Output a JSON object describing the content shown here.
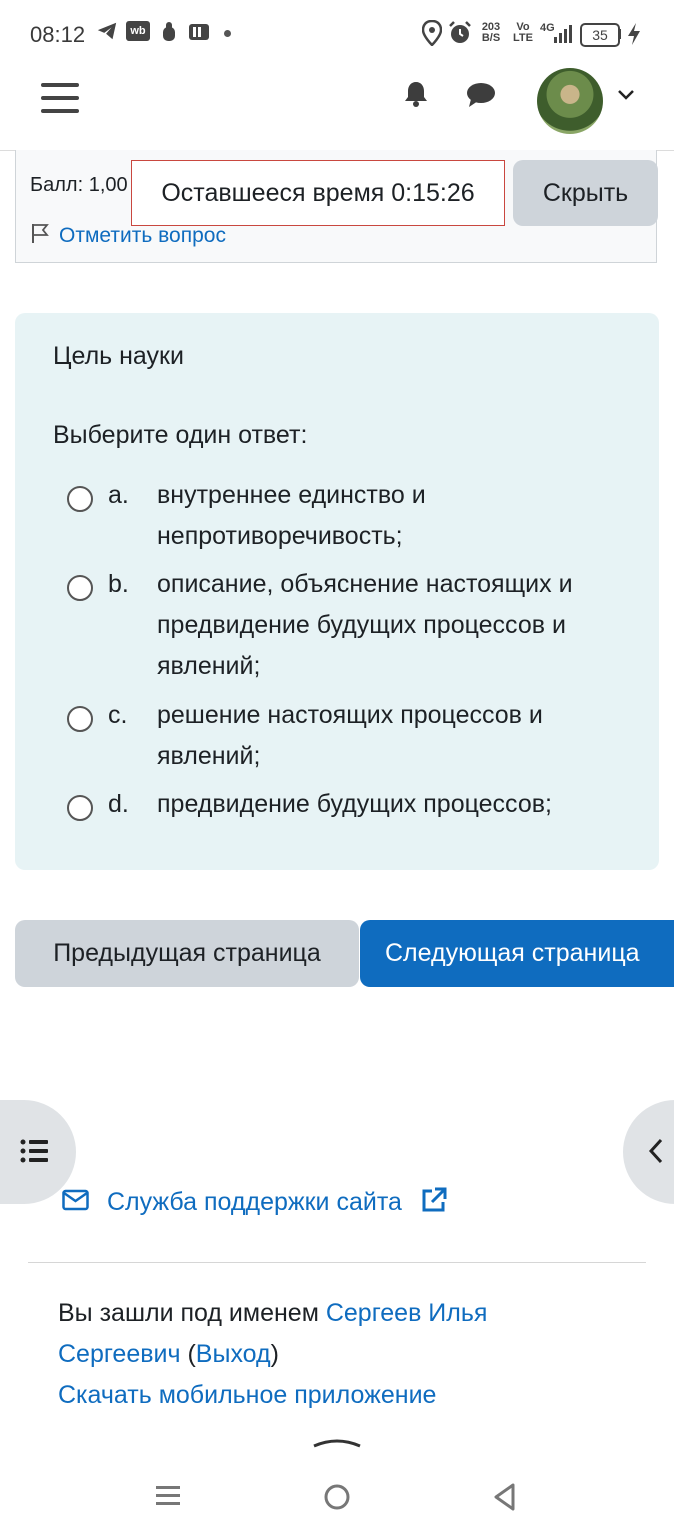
{
  "status_bar": {
    "time": "08:12",
    "speed_value": "203",
    "speed_unit": "B/S",
    "volte": "Vo LTE",
    "network": "4G",
    "battery": "35"
  },
  "quiz_info": {
    "score": "Балл: 1,00",
    "flag_label": "Отметить вопрос",
    "timer": "Оставшееся время 0:15:26",
    "hide_button": "Скрыть"
  },
  "question": {
    "text": "Цель науки",
    "prompt": "Выберите один ответ:",
    "options": [
      {
        "letter": "a.",
        "text": "внутреннее единство и непротиворечивость;"
      },
      {
        "letter": "b.",
        "text": "описание, объяснение настоящих и предвидение будущих процессов и явлений;"
      },
      {
        "letter": "c.",
        "text": "решение настоящих процессов и явлений;"
      },
      {
        "letter": "d.",
        "text": "предвидение будущих процессов;"
      }
    ]
  },
  "navigation": {
    "prev": "Предыдущая страница",
    "next": "Следующая страница"
  },
  "footer": {
    "support": "Служба поддержки сайта",
    "logged_in_as": "Вы зашли под именем",
    "user_name_1": "Сергеев Илья",
    "user_name_2": "Сергеевич",
    "logout_open": "(",
    "logout": "Выход",
    "logout_close": ")",
    "mobile_app": "Скачать мобильное приложение"
  },
  "icons": {
    "menu": "hamburger-icon",
    "notifications": "bell-icon",
    "messages": "chat-bubble-icon",
    "user_menu": "chevron-down-icon",
    "flag": "flag-icon",
    "course_index": "list-icon",
    "blocks_drawer": "chevron-left-icon",
    "support": "envelope-icon",
    "external": "external-link-icon"
  },
  "colors": {
    "primary": "#0f6cbf",
    "question_bg": "#e7f3f5",
    "timer_border": "#c9473f",
    "secondary_button": "#ced4da"
  }
}
